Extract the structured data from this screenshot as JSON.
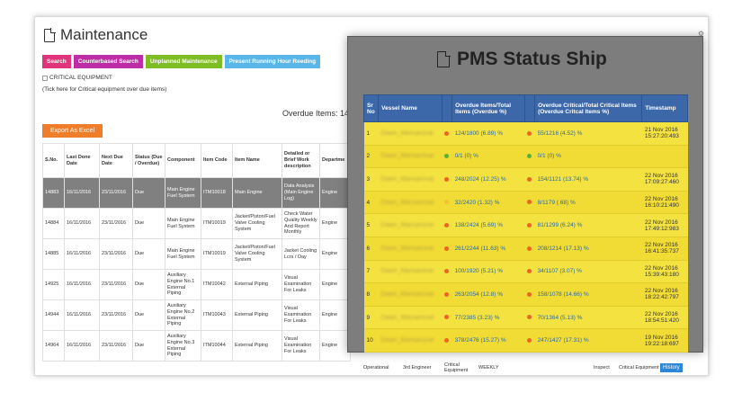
{
  "back_window": {
    "title": "Maintenance",
    "buttons": [
      {
        "label": "Search",
        "color": "#e0357a"
      },
      {
        "label": "Counterbased Search",
        "color": "#bd2ea6"
      },
      {
        "label": "Unplanned Maintenance",
        "color": "#7fbd25"
      },
      {
        "label": "Present Running Hour Reeding",
        "color": "#59b6e8"
      }
    ],
    "critical_label": "CRITICAL EQUIPMENT",
    "critical_hint": "(Tick here for Critical equipment over due items)",
    "overdue_label": "Overdue Items: 14",
    "export_label": "Export As Excel",
    "columns": [
      "S.No.",
      "Last Done Date",
      "Next Due Date",
      "Status (Due / Overdue)",
      "Component",
      "Item Code",
      "Item Name",
      "Detailed or Brief Work description",
      "Departme"
    ],
    "rows": [
      [
        "14883",
        "16/11/2016",
        "23/11/2016",
        "Due",
        "Main Engine Fuel System",
        "ITM10018",
        "Main Engine",
        "Data Analysis (Main Engine Log)",
        "Engine"
      ],
      [
        "14884",
        "16/11/2016",
        "23/11/2016",
        "Due",
        "Main Engine Fuel System",
        "ITM10019",
        "Jacket/Piston/Fuel Valve Cooling System",
        "Check Water Quality Weekly And Report Monthly",
        "Engine"
      ],
      [
        "14885",
        "16/11/2016",
        "23/11/2016",
        "Due",
        "Main Engine Fuel System",
        "ITM10019",
        "Jacket/Piston/Fuel Valve Cooling System",
        "Jacket Cooling Lcrs / Day",
        "Engine"
      ],
      [
        "14925",
        "16/11/2016",
        "23/11/2016",
        "Due",
        "Auxiliary Engine No.1 External Piping",
        "ITM10042",
        "External Piping",
        "Visual Examination For Leaks",
        "Engine"
      ],
      [
        "14944",
        "16/11/2016",
        "23/11/2016",
        "Due",
        "Auxiliary Engine No.2 External Piping",
        "ITM10043",
        "External Piping",
        "Visual Examination For Leaks",
        "Engine"
      ],
      [
        "14964",
        "16/11/2016",
        "23/11/2016",
        "Due",
        "Auxiliary Engine No.3 External Piping",
        "ITM10044",
        "External Piping",
        "Visual Examination For Leaks",
        "Engine"
      ]
    ],
    "last_row_extra": {
      "status": "Operational",
      "rank": "3rd Engineer",
      "category": "Critical Equipment",
      "frequency": "WEEKLY",
      "action": "Inspect",
      "category2": "Critical Equipment",
      "history_label": "History"
    }
  },
  "front_window": {
    "title": "PMS Status Ship",
    "columns": [
      "Sr No",
      "Vessel Name",
      "",
      "Overdue Items/Total Items (Overdue %)",
      "",
      "Overdue Critical/Total Critical Items (Overdue Critcal Items %)",
      "Timestamp"
    ],
    "rows": [
      {
        "sr": "1",
        "vessel": "Dawn_Mansarovar",
        "dot1": "#e8661f",
        "overdue": "124/1800 (6.89) %",
        "dot2": "#e8661f",
        "critical": "55/1216 (4.52) %",
        "timestamp": "21 Nov 2016 15:27:20:493"
      },
      {
        "sr": "2",
        "vessel": "Dawn_Mansarovar",
        "dot1": "#5cae38",
        "overdue": "0/1 (0) %",
        "dot2": "#5cae38",
        "critical": "0/1 (0) %",
        "timestamp": ""
      },
      {
        "sr": "3",
        "vessel": "Dawn_Mansarovar",
        "dot1": "#e8661f",
        "overdue": "248/2024 (12.25) %",
        "dot2": "#e8661f",
        "critical": "154/1121 (13.74) %",
        "timestamp": "22 Nov 2016 17:09:27:460"
      },
      {
        "sr": "4",
        "vessel": "Dawn_Mansarovar",
        "dot1": "#f5c232",
        "overdue": "32/2420 (1.32) %",
        "dot2": "#e8661f",
        "critical": "8/1179 (.68) %",
        "timestamp": "22 Nov 2016 16:10:21:490"
      },
      {
        "sr": "5",
        "vessel": "Dawn_Mansarovar",
        "dot1": "#e8661f",
        "overdue": "138/2424 (5.69) %",
        "dot2": "#e8661f",
        "critical": "81/1299 (6.24) %",
        "timestamp": "22 Nov 2016 17:49:12:983"
      },
      {
        "sr": "6",
        "vessel": "Dawn_Mansarovar",
        "dot1": "#e8661f",
        "overdue": "261/2244 (11.63) %",
        "dot2": "#e8661f",
        "critical": "208/1214 (17.13) %",
        "timestamp": "22 Nov 2016 16:41:35:737"
      },
      {
        "sr": "7",
        "vessel": "Dawn_Mansarovar",
        "dot1": "#e8661f",
        "overdue": "100/1920 (5.21) %",
        "dot2": "#e8661f",
        "critical": "34/1107 (3.07) %",
        "timestamp": "22 Nov 2016 15:39:43:180"
      },
      {
        "sr": "8",
        "vessel": "Dawn_Mansarovar",
        "dot1": "#e8661f",
        "overdue": "263/2054 (12.8) %",
        "dot2": "#e8661f",
        "critical": "158/1078 (14.66) %",
        "timestamp": "22 Nov 2016 18:22:42:797"
      },
      {
        "sr": "9",
        "vessel": "Dawn_Mansarovar",
        "dot1": "#e8661f",
        "overdue": "77/2385 (3.23) %",
        "dot2": "#e8661f",
        "critical": "70/1364 (5.13) %",
        "timestamp": "22 Nov 2016 18:54:51:420"
      },
      {
        "sr": "10",
        "vessel": "Dawn_Mansarovar",
        "dot1": "#e8661f",
        "overdue": "378/2476 (15.27) %",
        "dot2": "#e8661f",
        "critical": "247/1427 (17.31) %",
        "timestamp": "19 Nov 2016 19:22:18:697"
      }
    ]
  }
}
